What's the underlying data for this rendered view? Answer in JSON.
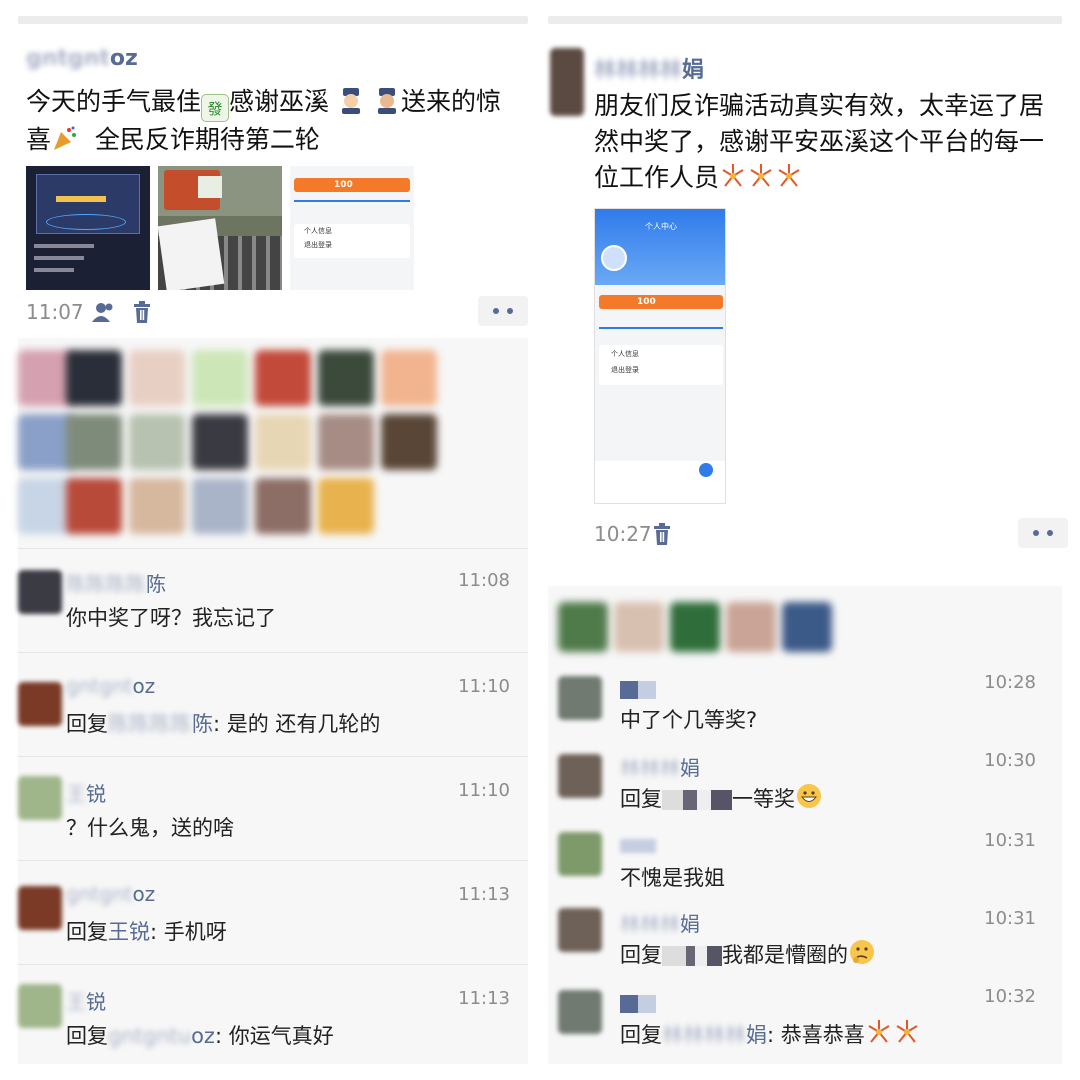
{
  "left": {
    "post": {
      "user": "gntgntuoz",
      "user_visible_suffix": "oz",
      "text_line1": "今天的手气最佳",
      "text_after_tile": "感谢巫溪",
      "text_line1_end": "送来的惊",
      "text_line2_start": "喜",
      "text_line2_end": "全民反诈期待第二轮",
      "time": "11:07",
      "emoji_mahjong": "mahjong-green-dragon-icon",
      "thumb3_pill": "100",
      "thumb3_items": [
        "个人信息",
        "退出登录"
      ]
    },
    "comments": [
      {
        "name_blur": "陈陈陈陈",
        "name_clear": "陈",
        "time": "11:08",
        "text": "你中奖了呀？我忘记了"
      },
      {
        "name_blur": "gntgnt",
        "name_clear": "oz",
        "time": "11:10",
        "prefix": "回复",
        "target_blur": "陈陈陈陈",
        "target_clear": "陈",
        "text": ": 是的  还有几轮的"
      },
      {
        "name_blur": "王",
        "name_clear": "锐",
        "time": "11:10",
        "text": "？什么鬼，送的啥"
      },
      {
        "name_blur": "gntgnt",
        "name_clear": "oz",
        "time": "11:13",
        "prefix": "回复",
        "target": "王锐",
        "text": ": 手机呀"
      },
      {
        "name_blur": "王",
        "name_clear": "锐",
        "time": "11:13",
        "prefix": "回复",
        "target_blur": "gntgntu",
        "target_clear": "oz",
        "text": ": 你运气真好"
      }
    ]
  },
  "right": {
    "post": {
      "user_blur": "林林林林",
      "user_clear": "娟",
      "text_line1": "朋友们反诈骗活动真实有效，太幸运了居",
      "text_line2": "然中奖了，感谢平安巫溪这个平台的每一",
      "text_line3": "位工作人员",
      "time": "10:27",
      "phone_title": "个人中心",
      "phone_pill": "100",
      "phone_items": [
        "个人信息",
        "退出登录"
      ]
    },
    "comments": [
      {
        "time": "10:28",
        "text": "中了个几等奖?"
      },
      {
        "name_blur": "林林林",
        "name_clear": "娟",
        "time": "10:30",
        "prefix": "回复",
        "text": "一等奖"
      },
      {
        "time": "10:31",
        "text": "不愧是我姐"
      },
      {
        "name_blur": "林林林",
        "name_clear": "娟",
        "time": "10:31",
        "prefix": "回复",
        "text": "我都是懵圈的"
      },
      {
        "time": "10:32",
        "prefix": "回复",
        "target_blur": "林林林林",
        "target_clear": "娟",
        "text": ": 恭喜恭喜"
      }
    ]
  },
  "colors": {
    "link_blue": "#576b95",
    "time_gray": "#8c8c8c",
    "comment_bg": "#f7f7f7",
    "accent_orange": "#f47a2a",
    "accent_blue": "#2f7bea"
  }
}
